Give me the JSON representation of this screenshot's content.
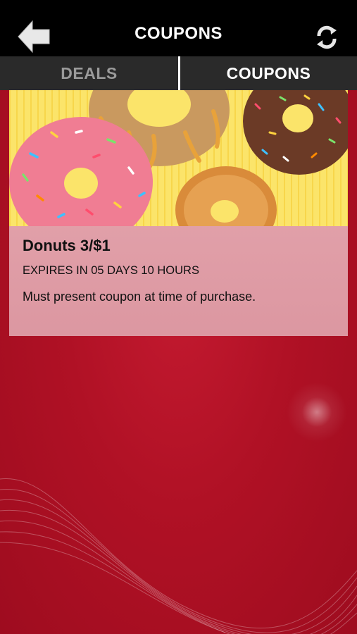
{
  "header": {
    "title": "COUPONS",
    "back_icon": "back-arrow-icon",
    "refresh_icon": "refresh-icon"
  },
  "tabs": [
    {
      "label": "DEALS",
      "active": false
    },
    {
      "label": "COUPONS",
      "active": true
    }
  ],
  "coupon": {
    "image": "donuts-image",
    "title": "Donuts 3/$1",
    "expiry": "EXPIRES IN 05 DAYS 10 HOURS",
    "terms": "Must present coupon at time of purchase."
  },
  "colors": {
    "topbar": "#000000",
    "tabbar": "#2a2a2a",
    "background_red": "#b01125",
    "card_pink": "#e3a3ac",
    "inactive_tab": "#9a9a9a"
  }
}
